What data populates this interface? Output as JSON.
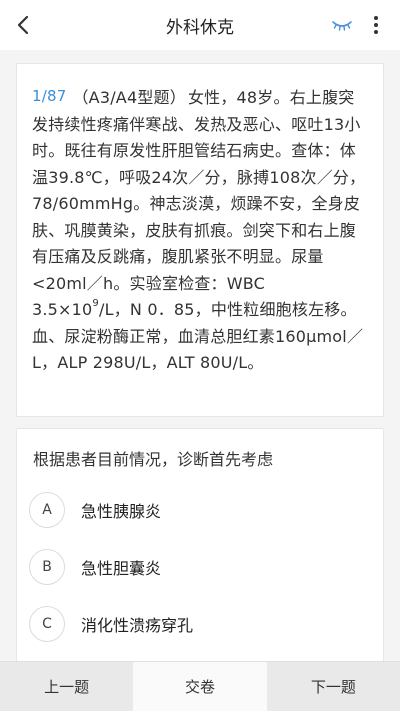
{
  "header": {
    "title": "外科休克",
    "back_icon": "chevron-left-icon",
    "eye_icon": "eye-closed-icon",
    "more_icon": "more-vertical-icon",
    "eye_color": "#4a90d9"
  },
  "stem": {
    "index": "1/87",
    "type": "（A3/A4型题）",
    "text_before_sup": "女性，48岁。右上腹突发持续性疼痛伴寒战、发热及恶心、呕吐13小时。既往有原发性肝胆管结石病史。查体：体温39.8℃，呼吸24次／分，脉搏108次／分，78/60mmHg。神志淡漠，烦躁不安，全身皮肤、巩膜黄染，皮肤有抓痕。剑突下和右上腹有压痛及反跳痛，腹肌紧张不明显。尿量<20ml／h。实验室检查：WBC 3.5×10",
    "sup": "9",
    "text_after_sup": "/L，N 0．85，中性粒细胞核左移。血、尿淀粉酶正常，血清总胆红素160μmol／L，ALP 298U/L，ALT 80U/L。",
    "index_color": "#3c8fd8"
  },
  "question": {
    "text": "根据患者目前情况，诊断首先考虑",
    "options": [
      {
        "letter": "A",
        "text": "急性胰腺炎"
      },
      {
        "letter": "B",
        "text": "急性胆囊炎"
      },
      {
        "letter": "C",
        "text": "消化性溃疡穿孔"
      }
    ]
  },
  "bottom_bar": {
    "prev_label": "上一题",
    "submit_label": "交卷",
    "next_label": "下一题"
  }
}
